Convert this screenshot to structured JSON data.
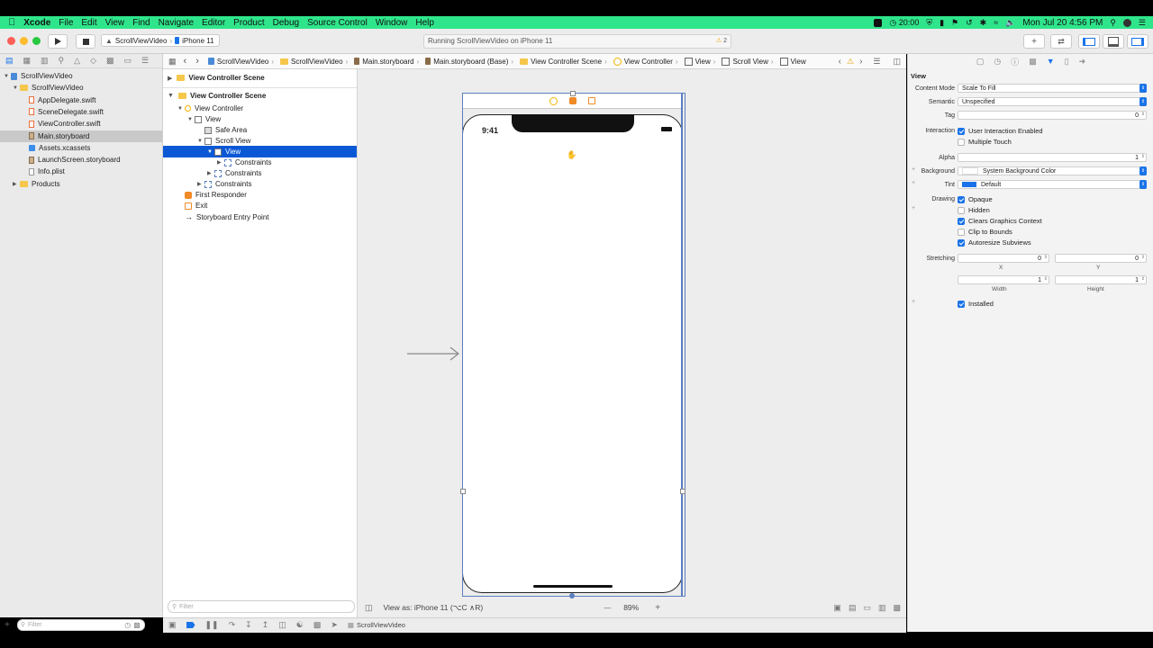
{
  "menubar": {
    "items": [
      "Xcode",
      "File",
      "Edit",
      "View",
      "Find",
      "Navigate",
      "Editor",
      "Product",
      "Debug",
      "Source Control",
      "Window",
      "Help"
    ],
    "clock": "20:00",
    "datetime": "Mon Jul 20  4:56 PM"
  },
  "toolbar": {
    "scheme": "ScrollViewVideo",
    "device": "iPhone 11",
    "activity": "Running ScrollViewVideo on iPhone 11",
    "warning_count": "2"
  },
  "navigator": {
    "items": [
      {
        "label": "ScrollViewVideo",
        "level": 0,
        "kind": "project",
        "expanded": true
      },
      {
        "label": "ScrollViewVideo",
        "level": 1,
        "kind": "folder",
        "expanded": true
      },
      {
        "label": "AppDelegate.swift",
        "level": 2,
        "kind": "swift"
      },
      {
        "label": "SceneDelegate.swift",
        "level": 2,
        "kind": "swift"
      },
      {
        "label": "ViewController.swift",
        "level": 2,
        "kind": "swift"
      },
      {
        "label": "Main.storyboard",
        "level": 2,
        "kind": "storyboard",
        "selected": true
      },
      {
        "label": "Assets.xcassets",
        "level": 2,
        "kind": "assets"
      },
      {
        "label": "LaunchScreen.storyboard",
        "level": 2,
        "kind": "storyboard"
      },
      {
        "label": "Info.plist",
        "level": 2,
        "kind": "plist"
      },
      {
        "label": "Products",
        "level": 1,
        "kind": "folder",
        "expanded": false
      }
    ],
    "filter_placeholder": "Filter"
  },
  "jumpbar": {
    "crumbs": [
      "ScrollViewVideo",
      "ScrollViewVideo",
      "Main.storyboard",
      "Main.storyboard (Base)",
      "View Controller Scene",
      "View Controller",
      "View",
      "Scroll View",
      "View"
    ]
  },
  "outline": {
    "collapsed_scene": "View Controller Scene",
    "scene": "View Controller Scene",
    "items": [
      {
        "label": "View Controller",
        "level": 1,
        "kind": "vc",
        "arrow": "down"
      },
      {
        "label": "View",
        "level": 2,
        "kind": "view",
        "arrow": "down"
      },
      {
        "label": "Safe Area",
        "level": 3,
        "kind": "safe",
        "arrow": ""
      },
      {
        "label": "Scroll View",
        "level": 3,
        "kind": "view",
        "arrow": "down"
      },
      {
        "label": "View",
        "level": 4,
        "kind": "view",
        "arrow": "down",
        "selected": true
      },
      {
        "label": "Constraints",
        "level": 5,
        "kind": "constraints",
        "arrow": "right"
      },
      {
        "label": "Constraints",
        "level": 4,
        "kind": "constraints",
        "arrow": "right"
      },
      {
        "label": "Constraints",
        "level": 3,
        "kind": "constraints",
        "arrow": "right"
      },
      {
        "label": "First Responder",
        "level": 1,
        "kind": "responder",
        "arrow": ""
      },
      {
        "label": "Exit",
        "level": 1,
        "kind": "exit",
        "arrow": ""
      },
      {
        "label": "Storyboard Entry Point",
        "level": 1,
        "kind": "entry",
        "arrow": ""
      }
    ],
    "filter_placeholder": "Filter"
  },
  "canvas": {
    "status_time": "9:41",
    "view_as": "View as: iPhone 11 (⌥C ∧R)",
    "zoom": "89%",
    "minus": "—",
    "plus": "+"
  },
  "inspector": {
    "section": "View",
    "content_mode_label": "Content Mode",
    "content_mode": "Scale To Fill",
    "semantic_label": "Semantic",
    "semantic": "Unspecified",
    "tag_label": "Tag",
    "tag": "0",
    "interaction_label": "Interaction",
    "user_interaction": "User Interaction Enabled",
    "multiple_touch": "Multiple Touch",
    "alpha_label": "Alpha",
    "alpha": "1",
    "background_label": "Background",
    "background": "System Background Color",
    "tint_label": "Tint",
    "tint": "Default",
    "drawing_label": "Drawing",
    "opaque": "Opaque",
    "hidden": "Hidden",
    "clears": "Clears Graphics Context",
    "clip": "Clip to Bounds",
    "autoresize": "Autoresize Subviews",
    "stretching_label": "Stretching",
    "stretch_x": "0",
    "stretch_y": "0",
    "x_label": "X",
    "y_label": "Y",
    "stretch_w": "1",
    "stretch_h": "1",
    "width_label": "Width",
    "height_label": "Height",
    "installed": "Installed",
    "accent_color": "#1a73e8"
  },
  "bottombar": {
    "target": "ScrollViewVideo"
  }
}
